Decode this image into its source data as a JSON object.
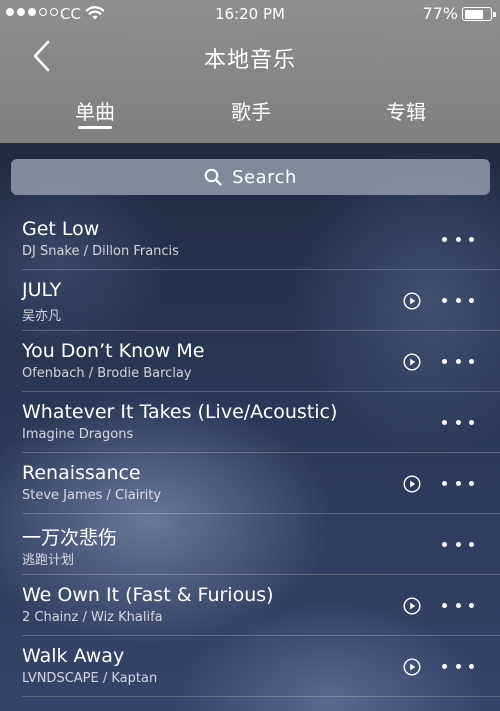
{
  "status_bar": {
    "carrier": "CC",
    "time": "16:20 PM",
    "battery": "77%",
    "battery_level": 0.77,
    "signal_bars_filled": 3,
    "signal_bars_total": 5
  },
  "nav": {
    "back_icon": "chevron-left-icon",
    "title": "本地音乐"
  },
  "tabs": [
    {
      "label": "单曲",
      "active": true
    },
    {
      "label": "歌手",
      "active": false
    },
    {
      "label": "专辑",
      "active": false
    }
  ],
  "search": {
    "icon": "search-icon",
    "placeholder": "Search"
  },
  "songs": [
    {
      "title": "Get Low",
      "artist": "DJ Snake / Dillon Francis",
      "has_mv": false
    },
    {
      "title": "JULY",
      "artist": "吴亦凡",
      "has_mv": true
    },
    {
      "title": "You Don’t Know Me",
      "artist": "Ofenbach / Brodie Barclay",
      "has_mv": true
    },
    {
      "title": "Whatever It Takes (Live/Acoustic)",
      "artist": "Imagine Dragons",
      "has_mv": false
    },
    {
      "title": "Renaissance",
      "artist": "Steve James / Clairity",
      "has_mv": true
    },
    {
      "title": "一万次悲伤",
      "artist": "逃跑计划",
      "has_mv": false
    },
    {
      "title": "We Own It (Fast & Furious)",
      "artist": "2 Chainz / Wiz Khalifa",
      "has_mv": true
    },
    {
      "title": "Walk Away",
      "artist": "LVNDSCAPE / Kaptan",
      "has_mv": true
    }
  ],
  "colors": {
    "header_bg": "#8e8e8e",
    "text": "#ffffff"
  }
}
